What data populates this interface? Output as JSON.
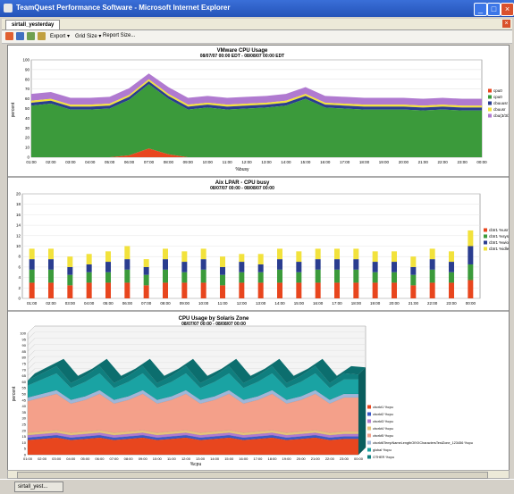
{
  "window": {
    "title": "TeamQuest Performance Software - Microsoft Internet Explorer"
  },
  "tab": {
    "label": "sirtall_yesterday"
  },
  "toolbar": {
    "export_label": "Export ▾",
    "gridsize_label": "Grid Size ▾",
    "reportsize_label": "Report Size..."
  },
  "taskbar": {
    "item_label": "sirtall_yest..."
  },
  "colors": {
    "green": "#3b9a3b",
    "purple": "#b07ad0",
    "navy": "#2a3d8f",
    "yellow": "#f2e23c",
    "red": "#e8461e",
    "teal": "#1aa3a3",
    "salmon": "#f4a08a",
    "blue": "#3a59c8",
    "tan": "#e6c37a"
  },
  "chart_data": [
    {
      "type": "area",
      "title": "VMware CPU Usage",
      "subtitle": "08/07/07 00:00 EDT - 08/08/07 00:00 EDT",
      "xlabel": "%busy",
      "ylabel": "percent",
      "ylim": [
        0,
        100
      ],
      "yticks": [
        "0",
        "10",
        "20",
        "30",
        "40",
        "50",
        "60",
        "70",
        "80",
        "90",
        "100"
      ],
      "categories": [
        "01:00",
        "02:00",
        "03:00",
        "04:00",
        "05:00",
        "06:00",
        "07:00",
        "08:00",
        "09:00",
        "10:00",
        "11:00",
        "12:00",
        "13:00",
        "14:00",
        "15:00",
        "16:00",
        "17:00",
        "18:00",
        "19:00",
        "20:00",
        "21:00",
        "22:00",
        "23:00",
        "00:00"
      ],
      "series": [
        {
          "name": "cpu0",
          "values": [
            0,
            0,
            0,
            0,
            0,
            2,
            9,
            3,
            0,
            0,
            0,
            0,
            0,
            0,
            0,
            0,
            0,
            0,
            0,
            0,
            0,
            0,
            0,
            0
          ]
        },
        {
          "name": "cpu0",
          "values": [
            53,
            55,
            49,
            49,
            50,
            57,
            66,
            57,
            49,
            51,
            49,
            50,
            51,
            53,
            60,
            51,
            50,
            49,
            49,
            49,
            48,
            49,
            48,
            48
          ]
        },
        {
          "name": "cbuuusr",
          "values": [
            3,
            3,
            3,
            3,
            3,
            3,
            3,
            3,
            3,
            3,
            3,
            3,
            3,
            3,
            3,
            3,
            3,
            3,
            3,
            3,
            3,
            3,
            3,
            3
          ]
        },
        {
          "name": "cbuusr",
          "values": [
            2,
            2,
            2,
            2,
            2,
            2,
            2,
            2,
            2,
            2,
            2,
            2,
            2,
            2,
            2,
            2,
            2,
            2,
            2,
            2,
            2,
            2,
            2,
            2
          ]
        },
        {
          "name": "cbu(3/3/3)",
          "values": [
            7,
            7,
            7,
            7,
            7,
            7,
            6,
            7,
            7,
            7,
            7,
            7,
            7,
            7,
            7,
            7,
            7,
            7,
            7,
            7,
            7,
            7,
            7,
            7
          ]
        }
      ]
    },
    {
      "type": "bar",
      "title": "Aix LPAR - CPU busy",
      "subtitle": "08/07/07 00:00 - 08/08/07 00:00",
      "ylim": [
        0,
        20
      ],
      "yticks": [
        "0",
        "2",
        "4",
        "6",
        "8",
        "10",
        "12",
        "14",
        "16",
        "18",
        "20"
      ],
      "categories": [
        "01:00",
        "02:00",
        "03:00",
        "04:00",
        "05:00",
        "06:00",
        "07:00",
        "08:00",
        "09:00",
        "10:00",
        "11:00",
        "12:00",
        "13:00",
        "14:00",
        "15:00",
        "16:00",
        "17:00",
        "18:00",
        "19:00",
        "20:00",
        "21:00",
        "22:00",
        "23:00",
        "00:00"
      ],
      "series": [
        {
          "name": "cbtr1 %usr",
          "values": [
            3,
            3,
            2.5,
            3,
            3,
            3,
            2.5,
            3,
            3,
            3,
            2.5,
            3,
            3,
            3,
            3,
            3,
            3,
            3,
            3,
            3,
            2.5,
            3,
            3,
            3.5
          ]
        },
        {
          "name": "cbtr1 %sys",
          "values": [
            2.5,
            2.5,
            2,
            2,
            2,
            2.5,
            2,
            2.5,
            2,
            2.5,
            2,
            2,
            2,
            2.5,
            2,
            2.5,
            2.5,
            2.5,
            2,
            2,
            2,
            2.5,
            2,
            3
          ]
        },
        {
          "name": "cbtr1 %wio",
          "values": [
            2,
            2,
            1.5,
            1.5,
            2,
            2,
            1.5,
            2,
            2,
            2,
            1.5,
            2,
            1.5,
            2,
            2,
            2,
            2,
            2,
            2,
            2,
            1.5,
            2,
            2,
            3.5
          ]
        },
        {
          "name": "cbtr1 %idle",
          "values": [
            2,
            2,
            2,
            2,
            2,
            2.5,
            1.5,
            2,
            2,
            2,
            2,
            1.5,
            2,
            2,
            2,
            2,
            2,
            2,
            2,
            2,
            2,
            2,
            2,
            3
          ]
        }
      ]
    },
    {
      "type": "area",
      "title": "CPU Usage by Solaris Zone",
      "subtitle": "08/07/07 00:00 - 08/08/07 00:00",
      "xlabel": "%cpu",
      "ylabel": "percent",
      "ylim": [
        0,
        100
      ],
      "yticks": [
        "0",
        "5",
        "10",
        "15",
        "20",
        "25",
        "30",
        "35",
        "40",
        "45",
        "50",
        "55",
        "60",
        "65",
        "70",
        "75",
        "80",
        "85",
        "90",
        "95",
        "100"
      ],
      "categories": [
        "01:00",
        "02:00",
        "03:00",
        "04:00",
        "05:00",
        "06:00",
        "07:00",
        "08:00",
        "09:00",
        "10:00",
        "11:00",
        "12:00",
        "13:00",
        "14:00",
        "15:00",
        "16:00",
        "17:00",
        "18:00",
        "19:00",
        "20:00",
        "21:00",
        "22:00",
        "23:00",
        "00:00"
      ],
      "series": [
        {
          "name": "cbcrkt1 %cpu",
          "values": [
            12,
            13,
            14,
            12,
            13,
            14,
            12,
            13,
            14,
            12,
            13,
            14,
            12,
            13,
            14,
            12,
            13,
            14,
            12,
            13,
            14,
            12,
            13,
            13
          ]
        },
        {
          "name": "cbcrkt2 %cpu",
          "values": [
            2,
            2,
            2,
            2,
            2,
            2,
            2,
            2,
            2,
            2,
            2,
            2,
            2,
            2,
            2,
            2,
            2,
            2,
            2,
            2,
            2,
            2,
            2,
            2
          ]
        },
        {
          "name": "cbcrkt3 %cpu",
          "values": [
            2,
            2,
            2,
            2,
            2,
            2,
            2,
            2,
            2,
            2,
            2,
            2,
            2,
            2,
            2,
            2,
            2,
            2,
            2,
            2,
            2,
            2,
            2,
            2
          ]
        },
        {
          "name": "cbcrkt4 %cpu",
          "values": [
            2,
            2,
            2,
            2,
            2,
            2,
            2,
            2,
            2,
            2,
            2,
            2,
            2,
            2,
            2,
            2,
            2,
            2,
            2,
            2,
            2,
            2,
            2,
            2
          ]
        },
        {
          "name": "cbcrkt5 %cpu",
          "values": [
            26,
            28,
            30,
            24,
            26,
            30,
            24,
            26,
            30,
            24,
            26,
            30,
            24,
            26,
            30,
            24,
            26,
            30,
            24,
            26,
            30,
            24,
            28,
            28
          ]
        },
        {
          "name": "cbcrkt6TempNameLengthOfXXCharactersTestZone_123456 %cpu",
          "values": [
            3,
            3,
            3,
            3,
            3,
            3,
            3,
            3,
            3,
            3,
            3,
            3,
            3,
            3,
            3,
            3,
            3,
            3,
            3,
            3,
            3,
            3,
            3,
            3
          ]
        },
        {
          "name": "global %cpu",
          "values": [
            10,
            12,
            14,
            10,
            12,
            14,
            10,
            12,
            14,
            10,
            12,
            14,
            10,
            12,
            14,
            10,
            12,
            14,
            10,
            12,
            14,
            10,
            12,
            12
          ]
        },
        {
          "name": "OTHER %cpu",
          "values": [
            4,
            5,
            6,
            4,
            5,
            6,
            4,
            5,
            6,
            4,
            5,
            6,
            4,
            5,
            6,
            4,
            5,
            6,
            4,
            5,
            6,
            4,
            5,
            4
          ]
        }
      ]
    }
  ]
}
